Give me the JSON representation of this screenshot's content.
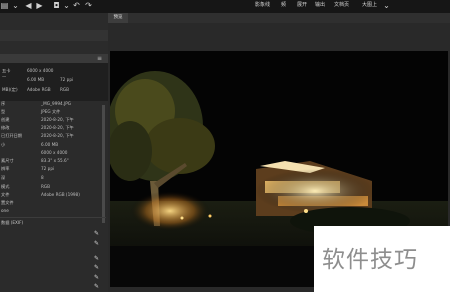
{
  "toolbar": {
    "menu": [
      "影象线",
      "频",
      "展开",
      "输出",
      "文档页",
      "大图上"
    ]
  },
  "tabs": {
    "preview": "预览"
  },
  "summary": {
    "format_label": "五卡",
    "dash": "—",
    "mode_label": "MB)(定)",
    "dimensions": "6000 x 4000",
    "size": "6.00 MB",
    "dpi": "72 ppi",
    "color_profile": "Adobe RGB",
    "color_mode": "RGB"
  },
  "metadata": {
    "rows": [
      {
        "label": "序",
        "value": "_MG_9994.JPG"
      },
      {
        "label": "型",
        "value": "JPEG 文件"
      },
      {
        "label": "创建",
        "value": "2020-8-20, 下午"
      },
      {
        "label": "修改",
        "value": "2020-8-20, 下午"
      },
      {
        "label": "已打开日期",
        "value": "2020-8-20, 下午"
      },
      {
        "label": "小",
        "value": "6.00 MB"
      },
      {
        "label": "",
        "value": "6000 x 4000"
      },
      {
        "label": "素尺寸",
        "value": "83.3\" x 55.6\""
      },
      {
        "label": "辨率",
        "value": "72 ppi"
      },
      {
        "label": "深",
        "value": "8"
      },
      {
        "label": "模式",
        "value": "RGB"
      },
      {
        "label": "文件",
        "value": "Adobe RGB (1998)"
      },
      {
        "label": "置文件",
        "value": ""
      },
      {
        "label": "one",
        "value": ""
      }
    ],
    "section_exif": "数据 (EXIF)"
  },
  "watermark": {
    "text": "软件技巧"
  }
}
